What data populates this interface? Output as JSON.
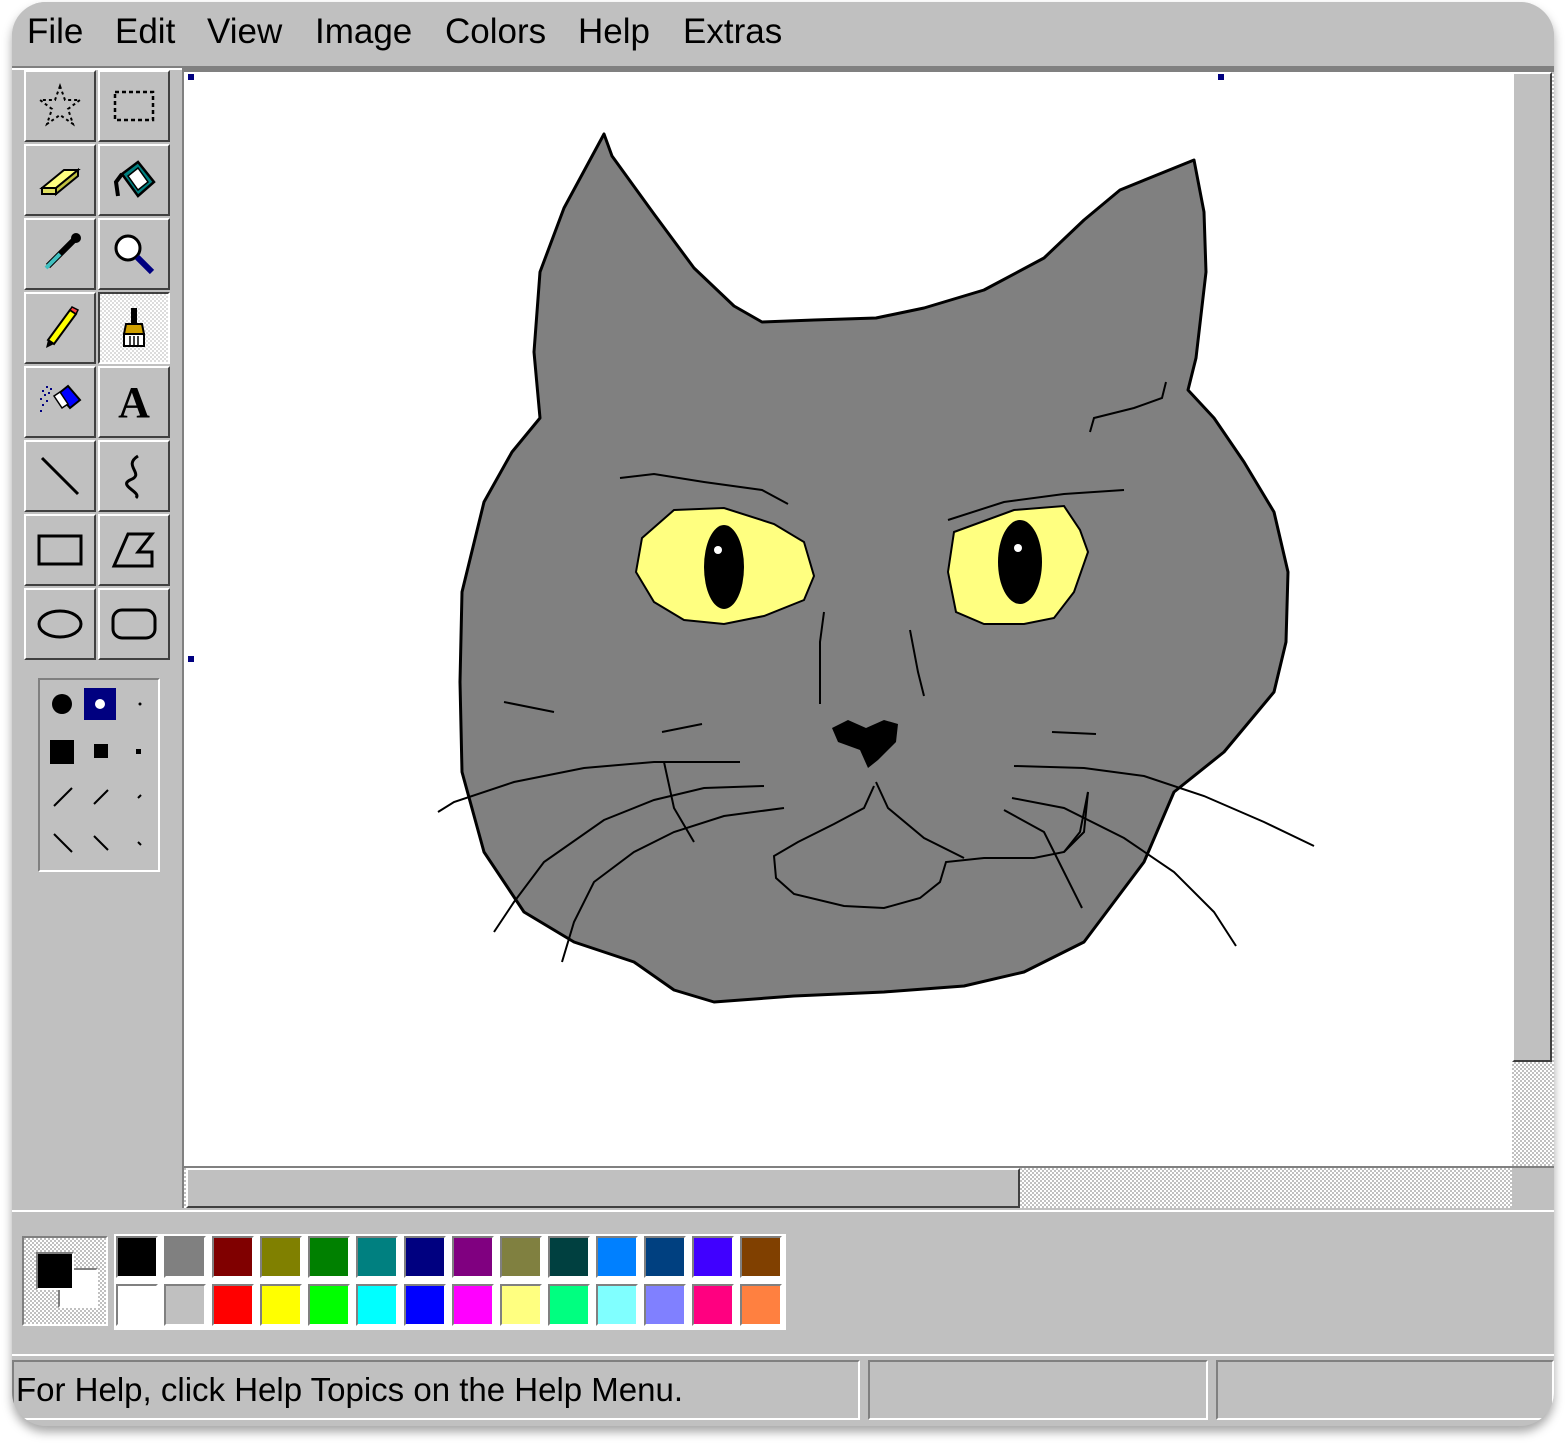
{
  "menu": {
    "file": "File",
    "edit": "Edit",
    "view": "View",
    "image": "Image",
    "colors": "Colors",
    "help": "Help",
    "extras": "Extras"
  },
  "tools": [
    {
      "name": "free-form-select",
      "icon": "star-select-icon"
    },
    {
      "name": "select",
      "icon": "rect-select-icon"
    },
    {
      "name": "eraser",
      "icon": "eraser-icon"
    },
    {
      "name": "fill-with-color",
      "icon": "paint-bucket-icon"
    },
    {
      "name": "pick-color",
      "icon": "eyedropper-icon"
    },
    {
      "name": "magnifier",
      "icon": "magnifier-icon"
    },
    {
      "name": "pencil",
      "icon": "pencil-icon"
    },
    {
      "name": "brush",
      "icon": "brush-icon",
      "selected": true
    },
    {
      "name": "airbrush",
      "icon": "airbrush-icon"
    },
    {
      "name": "text",
      "icon": "text-icon",
      "glyph": "A"
    },
    {
      "name": "line",
      "icon": "line-icon"
    },
    {
      "name": "curve",
      "icon": "curve-icon"
    },
    {
      "name": "rectangle",
      "icon": "rectangle-icon"
    },
    {
      "name": "polygon",
      "icon": "polygon-icon"
    },
    {
      "name": "ellipse",
      "icon": "ellipse-icon"
    },
    {
      "name": "rounded-rectangle",
      "icon": "rounded-rectangle-icon"
    }
  ],
  "colors": {
    "foreground": "#000000",
    "background": "#ffffff",
    "palette_top": [
      "#000000",
      "#808080",
      "#800000",
      "#808000",
      "#008000",
      "#008080",
      "#000080",
      "#800080",
      "#808040",
      "#004040",
      "#0080ff",
      "#004080",
      "#4000ff",
      "#804000"
    ],
    "palette_bottom": [
      "#ffffff",
      "#c0c0c0",
      "#ff0000",
      "#ffff00",
      "#00ff00",
      "#00ffff",
      "#0000ff",
      "#ff00ff",
      "#ffff80",
      "#00ff80",
      "#80ffff",
      "#8080ff",
      "#ff0080",
      "#ff8040"
    ]
  },
  "status": {
    "help_text": "For Help, click Help Topics on the Help Menu.",
    "coordinates": "",
    "size": ""
  }
}
